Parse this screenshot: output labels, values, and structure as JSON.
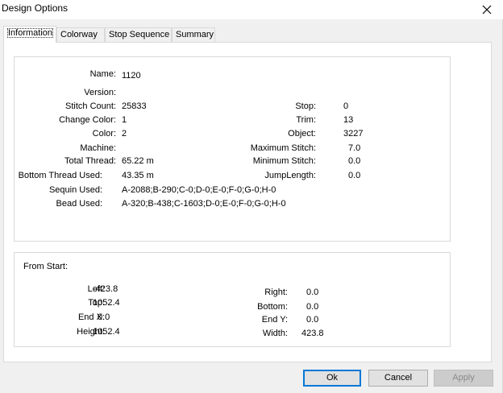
{
  "window": {
    "title": "Design Options"
  },
  "tabs": [
    {
      "label": "Information"
    },
    {
      "label": "Colorway"
    },
    {
      "label": "Stop Sequence"
    },
    {
      "label": "Summary"
    }
  ],
  "info": {
    "name_label": "Name:",
    "name_value": "1120",
    "version_label": "Version:",
    "version_value": "",
    "stitch_count_label": "Stitch Count:",
    "stitch_count_value": "25833",
    "change_color_label": "Change Color:",
    "change_color_value": "1",
    "color_label": "Color:",
    "color_value": "2",
    "machine_label": "Machine:",
    "machine_value": "",
    "total_thread_label": "Total Thread:",
    "total_thread_value": "65.22 m",
    "bottom_thread_label": "Bottom Thread Used:",
    "bottom_thread_value": "43.35 m",
    "sequin_label": "Sequin Used:",
    "sequin_value": "A-2088;B-290;C-0;D-0;E-0;F-0;G-0;H-0",
    "bead_label": "Bead Used:",
    "bead_value": "A-320;B-438;C-1603;D-0;E-0;F-0;G-0;H-0",
    "stop_label": "Stop:",
    "stop_value": "0",
    "trim_label": "Trim:",
    "trim_value": "13",
    "object_label": "Object:",
    "object_value": "3227",
    "max_stitch_label": "Maximum Stitch:",
    "max_stitch_value": "7.0",
    "min_stitch_label": "Minimum Stitch:",
    "min_stitch_value": "0.0",
    "jump_length_label": "JumpLength:",
    "jump_length_value": "0.0"
  },
  "from_start": {
    "heading": "From Start:",
    "left_label": "Left:",
    "left_value": "-423.8",
    "top_label": "Top:",
    "top_value": "1052.4",
    "end_x_label": "End X:",
    "end_x_value": "0.0",
    "height_label": "Height:",
    "height_value": "1052.4",
    "right_label": "Right:",
    "right_value": "0.0",
    "bottom_label": "Bottom:",
    "bottom_value": "0.0",
    "end_y_label": "End Y:",
    "end_y_value": "0.0",
    "width_label": "Width:",
    "width_value": "423.8"
  },
  "buttons": {
    "ok": "Ok",
    "cancel": "Cancel",
    "apply": "Apply"
  },
  "icons": {
    "close": "close-icon"
  },
  "colors": {
    "accent": "#0078d7",
    "panel_border": "#d9d9d9",
    "dialog_bg": "#f0f0f0"
  }
}
